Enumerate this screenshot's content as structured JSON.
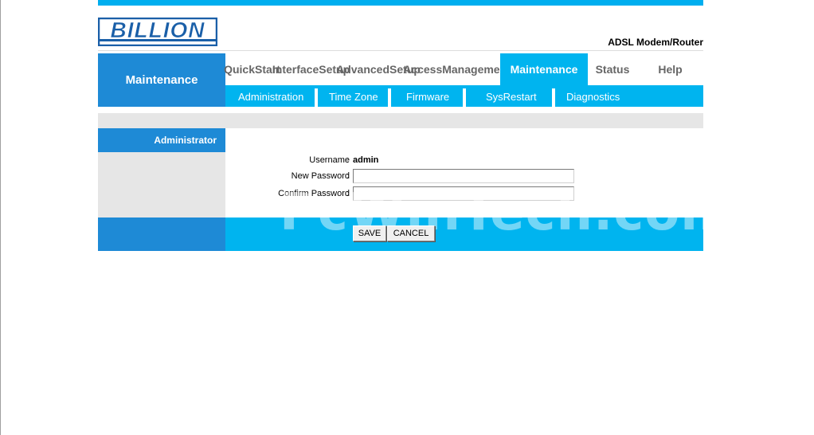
{
  "brand": {
    "logo_text": "BILLION",
    "product": "ADSL Modem/Router"
  },
  "section_title": "Maintenance",
  "menu": [
    {
      "label": "Quick Start",
      "active": false
    },
    {
      "label": "Interface Setup",
      "active": false
    },
    {
      "label": "Advanced Setup",
      "active": false
    },
    {
      "label": "Access Management",
      "active": false
    },
    {
      "label": "Maintenance",
      "active": true
    },
    {
      "label": "Status",
      "active": false
    },
    {
      "label": "Help",
      "active": false
    }
  ],
  "submenu": [
    "Administration",
    "Time Zone",
    "Firmware",
    "SysRestart",
    "Diagnostics"
  ],
  "sidebar": {
    "heading": "Administrator"
  },
  "form": {
    "username_label": "Username",
    "username_value": "admin",
    "new_password_label": "New Password",
    "new_password_value": "",
    "confirm_password_label": "Confirm Password",
    "confirm_password_value": "",
    "colon": ":"
  },
  "buttons": {
    "save": "SAVE",
    "cancel": "CANCEL"
  },
  "watermark": "PcWinTech.com",
  "colors": {
    "accent_cyan": "#00b4ef",
    "accent_blue": "#1e8ad6",
    "logo_blue": "#1a5fa8"
  }
}
